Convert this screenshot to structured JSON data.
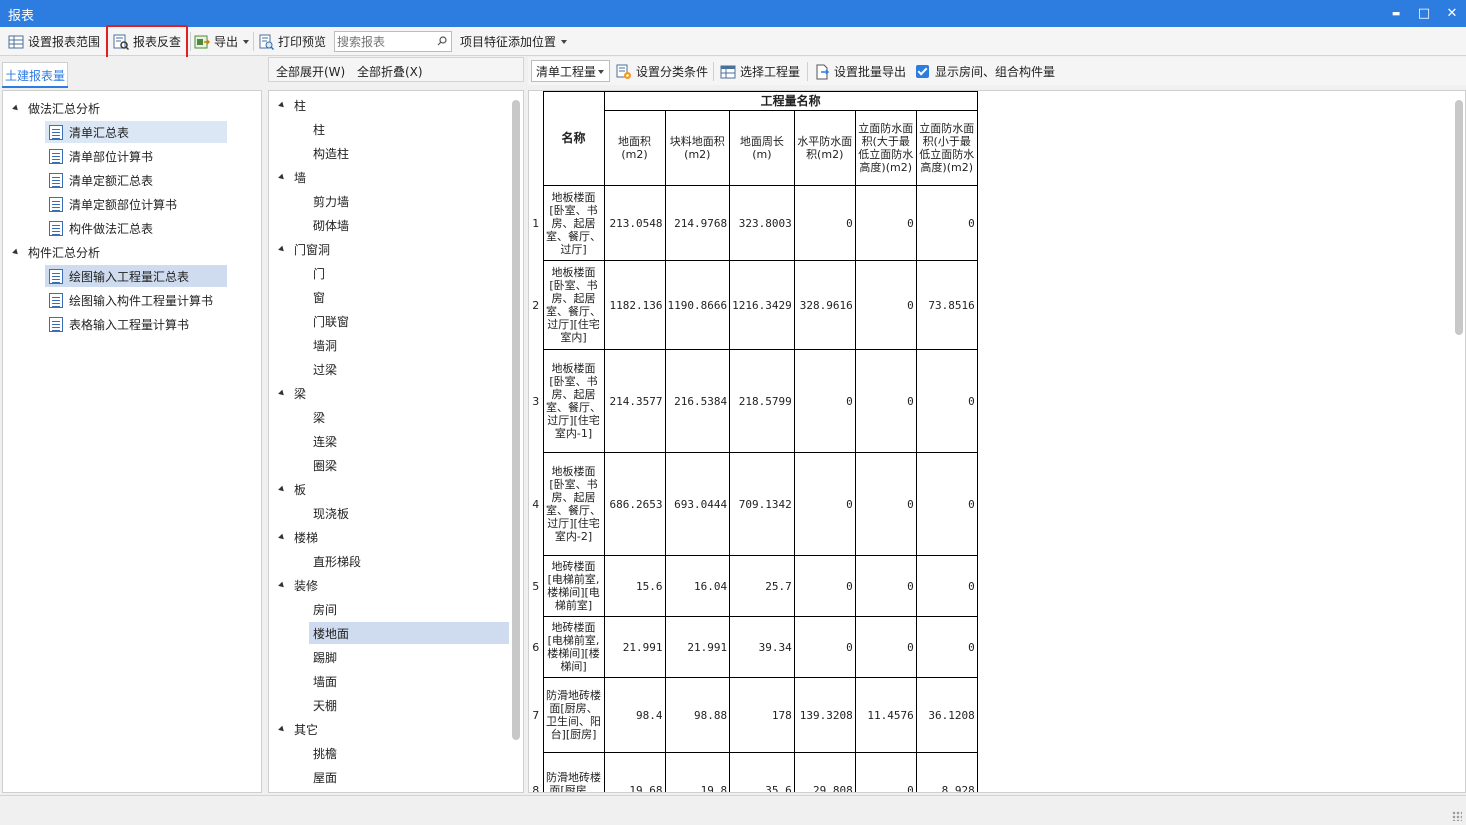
{
  "window": {
    "title": "报表",
    "minimize": "▬",
    "maximize": "□",
    "close": "✕"
  },
  "toolbar": {
    "set_scope": "设置报表范围",
    "report_lookup": "报表反查",
    "export": "导出",
    "print_preview": "打印预览",
    "search_placeholder": "搜索报表",
    "add_feature_position": "项目特征添加位置"
  },
  "left": {
    "tab": "土建报表量",
    "groups": [
      {
        "label": "做法汇总分析",
        "items": [
          "清单汇总表",
          "清单部位计算书",
          "清单定额汇总表",
          "清单定额部位计算书",
          "构件做法汇总表"
        ]
      },
      {
        "label": "构件汇总分析",
        "items": [
          "绘图输入工程量汇总表",
          "绘图输入构件工程量计算书",
          "表格输入工程量计算书"
        ]
      }
    ]
  },
  "middle": {
    "expand_all": "全部展开(W)",
    "collapse_all": "全部折叠(X)",
    "tree": [
      {
        "label": "柱",
        "children": [
          "柱",
          "构造柱"
        ]
      },
      {
        "label": "墙",
        "children": [
          "剪力墙",
          "砌体墙"
        ]
      },
      {
        "label": "门窗洞",
        "children": [
          "门",
          "窗",
          "门联窗",
          "墙洞",
          "过梁"
        ]
      },
      {
        "label": "梁",
        "children": [
          "梁",
          "连梁",
          "圈梁"
        ]
      },
      {
        "label": "板",
        "children": [
          "现浇板"
        ]
      },
      {
        "label": "楼梯",
        "children": [
          "直形梯段"
        ]
      },
      {
        "label": "装修",
        "children": [
          "房间",
          "楼地面",
          "踢脚",
          "墙面",
          "天棚"
        ]
      },
      {
        "label": "其它",
        "children": [
          "挑檐",
          "屋面"
        ]
      }
    ]
  },
  "right_toolbar": {
    "dropdown": "清单工程量",
    "set_classify": "设置分类条件",
    "select_quantity": "选择工程量",
    "batch_export": "设置批量导出",
    "show_rooms": "显示房间、组合构件量"
  },
  "table": {
    "group_header": "工程量名称",
    "name_header": "名称",
    "columns": [
      "地面积(m2)",
      "块料地面积(m2)",
      "地面周长(m)",
      "水平防水面积(m2)",
      "立面防水面积(大于最低立面防水高度)(m2)",
      "立面防水面积(小于最低立面防水高度)(m2)"
    ],
    "rows": [
      {
        "idx": "1",
        "name": "地板楼面[卧室、书房、起居室、餐厅、过厅]",
        "values": [
          "213.0548",
          "214.9768",
          "323.8003",
          "0",
          "0",
          "0"
        ]
      },
      {
        "idx": "2",
        "name": "地板楼面[卧室、书房、起居室、餐厅、过厅][住宅室内]",
        "values": [
          "1182.136",
          "1190.8666",
          "1216.3429",
          "328.9616",
          "0",
          "73.8516"
        ]
      },
      {
        "idx": "3",
        "name": "地板楼面[卧室、书房、起居室、餐厅、过厅][住宅室内-1]",
        "values": [
          "214.3577",
          "216.5384",
          "218.5799",
          "0",
          "0",
          "0"
        ]
      },
      {
        "idx": "4",
        "name": "地板楼面[卧室、书房、起居室、餐厅、过厅][住宅室内-2]",
        "values": [
          "686.2653",
          "693.0444",
          "709.1342",
          "0",
          "0",
          "0"
        ]
      },
      {
        "idx": "5",
        "name": "地砖楼面[电梯前室,楼梯间][电梯前室]",
        "values": [
          "15.6",
          "16.04",
          "25.7",
          "0",
          "0",
          "0"
        ]
      },
      {
        "idx": "6",
        "name": "地砖楼面[电梯前室,楼梯间][楼梯间]",
        "values": [
          "21.991",
          "21.991",
          "39.34",
          "0",
          "0",
          "0"
        ]
      },
      {
        "idx": "7",
        "name": "防滑地砖楼面[厨房、卫生间、阳台][厨房]",
        "values": [
          "98.4",
          "98.88",
          "178",
          "139.3208",
          "11.4576",
          "36.1208"
        ]
      },
      {
        "idx": "8",
        "name": "防滑地砖楼面[厨房、卫生",
        "values": [
          "19.68",
          "19.8",
          "35.6",
          "29.808",
          "0",
          "8.928"
        ]
      }
    ]
  }
}
